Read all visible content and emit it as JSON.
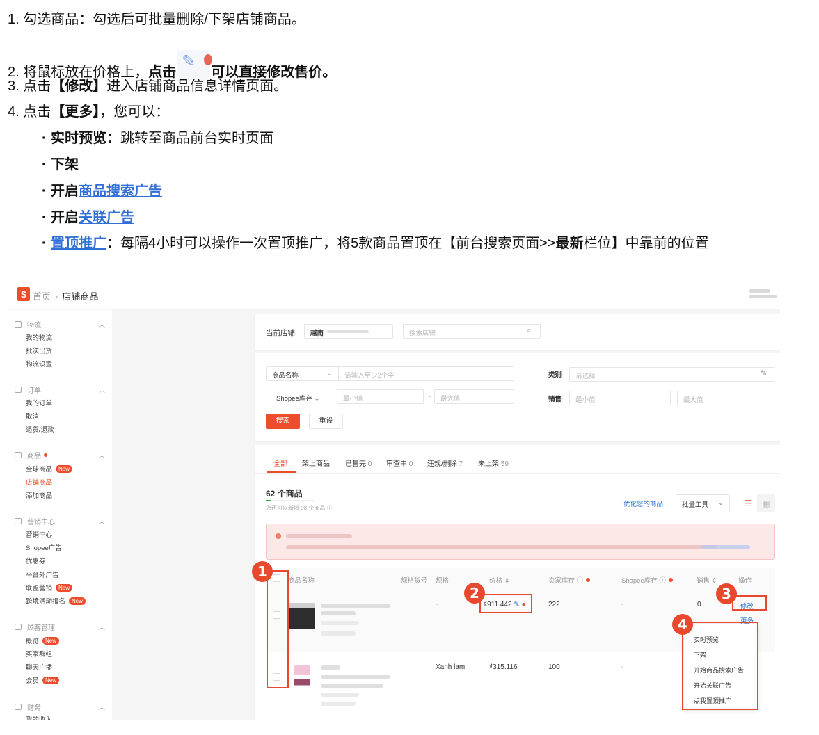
{
  "instructions": {
    "step1": {
      "prefix": "1. 勾选商品：勾选后可批量删除/下架店铺商品。"
    },
    "step2": {
      "prefix": "2. 将鼠标放在价格上，",
      "bold1": "点击",
      "bold2": "可以直接修改售价。"
    },
    "step3": {
      "prefix": "3. 点击",
      "bold": "【修改】",
      "suffix": "进入店铺商品信息详情页面。"
    },
    "step4": {
      "prefix": "4. 点击",
      "bold": "【更多】",
      "suffix": "，您可以："
    },
    "bullets": [
      {
        "bold": "实时预览：",
        "text": "跳转至商品前台实时页面"
      },
      {
        "bold": "下架"
      },
      {
        "bold": "开启",
        "link": "商品搜索广告"
      },
      {
        "bold": "开启",
        "link": "关联广告"
      },
      {
        "link": "置顶推广",
        "bold": "：",
        "text": "每隔4小时可以操作一次置顶推广，将5款商品置顶在【前台搜索页面>>",
        "bold2": "最新",
        "text2": "栏位】中靠前的位置"
      }
    ]
  },
  "screenshot": {
    "breadcrumb": {
      "logo": "S",
      "home": "首页",
      "separator": "›",
      "current": "店铺商品"
    },
    "sidebar": {
      "groups": [
        {
          "title": "物流",
          "icon": "truck-icon",
          "items": [
            {
              "label": "我的物流"
            },
            {
              "label": "批次出货"
            },
            {
              "label": "物流设置"
            }
          ]
        },
        {
          "title": "订单",
          "icon": "order-icon",
          "items": [
            {
              "label": "我的订单"
            },
            {
              "label": "取消"
            },
            {
              "label": "退货/退款"
            }
          ]
        },
        {
          "title": "商品",
          "icon": "product-icon",
          "dot": true,
          "items": [
            {
              "label": "全球商品",
              "badge": "New"
            },
            {
              "label": "店铺商品",
              "active": true
            },
            {
              "label": "添加商品"
            }
          ]
        },
        {
          "title": "营销中心",
          "icon": "tag-icon",
          "items": [
            {
              "label": "营销中心"
            },
            {
              "label": "Shopee广告"
            },
            {
              "label": "优惠券"
            },
            {
              "label": "平台外广告"
            },
            {
              "label": "联盟营销",
              "badge": "New"
            },
            {
              "label": "跨境活动报名",
              "badge": "New"
            }
          ]
        },
        {
          "title": "顾客管理",
          "icon": "user-icon",
          "items": [
            {
              "label": "概览",
              "badge": "New"
            },
            {
              "label": "买家群组"
            },
            {
              "label": "聊天广播"
            },
            {
              "label": "会员",
              "badge": "New"
            }
          ]
        },
        {
          "title": "财务",
          "icon": "wallet-icon",
          "items": [
            {
              "label": "我的收入"
            }
          ]
        }
      ]
    },
    "shop_bar": {
      "label": "当前店铺",
      "region": "越南",
      "shop_search_placeholder": "搜索店铺"
    },
    "filters": {
      "name_select": "商品名称",
      "name_placeholder": "请输入至少2个字",
      "category_label": "类别",
      "category_placeholder": "请选择",
      "stock_select": "Shopee库存",
      "min_placeholder": "最小值",
      "max_placeholder": "最大值",
      "sales_label": "销售",
      "range_sep": "-",
      "search_button": "搜索",
      "reset_button": "重设"
    },
    "tabs": [
      {
        "label": "全部",
        "active": true
      },
      {
        "label": "架上商品"
      },
      {
        "label": "已售完",
        "count": "0"
      },
      {
        "label": "审查中",
        "count": "0"
      },
      {
        "label": "违规/删除",
        "count": "7"
      },
      {
        "label": "未上架",
        "count": "59"
      }
    ],
    "summary": {
      "count_text": "62 个商品",
      "sub_text": "您还可以新增 98 个商品",
      "quota_used_fraction": 0.1
    },
    "toolbar": {
      "optimize_link": "优化您的商品",
      "bulk_tools": "批量工具"
    },
    "table": {
      "headers": [
        "商品名称",
        "规格货号",
        "规格",
        "价格 ⇕",
        "卖家库存",
        "Shopee库存",
        "销售 ⇕",
        "操作"
      ],
      "rows": [
        {
          "variation": "-",
          "price": "₫911.442",
          "seller_stock": "222",
          "shopee_stock": "-",
          "sales": "0",
          "actions": [
            "修改",
            "更多"
          ]
        },
        {
          "variation": "Xanh lam",
          "price": "₫315.116",
          "seller_stock": "100",
          "shopee_stock": "-"
        }
      ]
    },
    "more_menu": [
      "实时预览",
      "下架",
      "开始商品搜索广告",
      "开始关联广告",
      "点我置顶推广"
    ],
    "callouts": [
      "1",
      "2",
      "3",
      "4"
    ]
  },
  "colors": {
    "brand": "#ee4d2d",
    "callout": "#e8482e",
    "link": "#2f6fd6"
  }
}
